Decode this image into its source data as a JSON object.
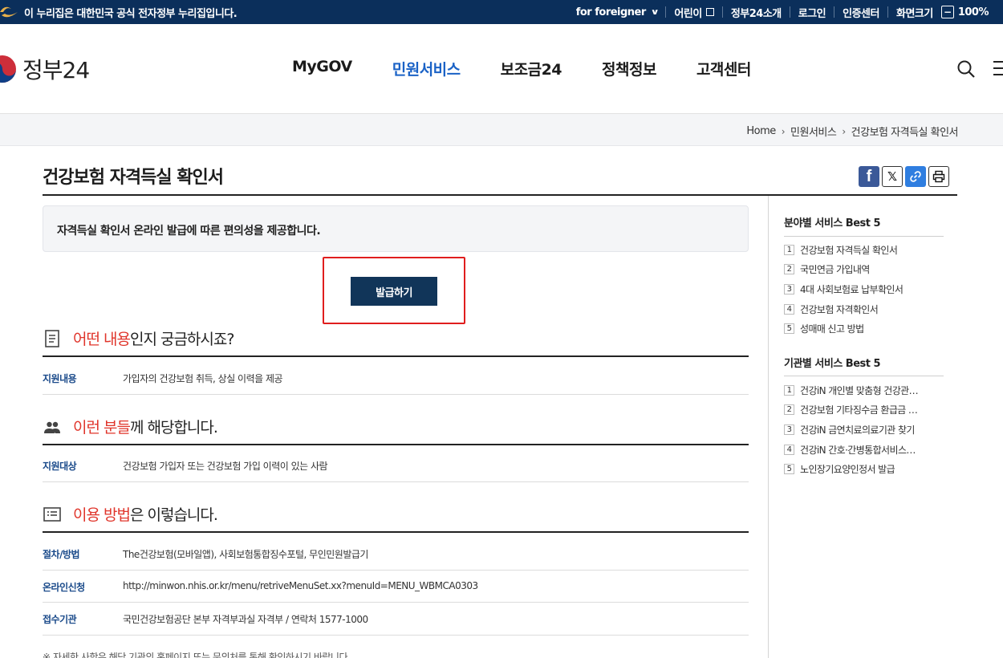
{
  "gov_banner": {
    "notice": "이 누리집은 대한민국 공식 전자정부 누리집입니다.",
    "utility_links": [
      "for foreigner",
      "어린이",
      "정부24소개",
      "로그인",
      "인증센터",
      "화면크기"
    ],
    "zoom_level": "100%"
  },
  "header": {
    "logo_text": "정부24",
    "nav": [
      "MyGOV",
      "민원서비스",
      "보조금24",
      "정책정보",
      "고객센터"
    ],
    "active_nav": "민원서비스"
  },
  "breadcrumb": [
    "Home",
    "민원서비스",
    "건강보험 자격득실 확인서"
  ],
  "page": {
    "title": "건강보험 자격득실 확인서",
    "summary": "자격득실 확인서 온라인 발급에 따른 편의성을 제공합니다.",
    "issue_button": "발급하기"
  },
  "sections": {
    "what": {
      "heading_red": "어떤 내용",
      "heading_rest": "인지 궁금하시죠?",
      "rows": [
        {
          "key": "지원내용",
          "value": "가입자의 건강보험 취득, 상실 이력을 제공"
        }
      ]
    },
    "who": {
      "heading_red": "이런 분들",
      "heading_rest": "께 해당합니다.",
      "rows": [
        {
          "key": "지원대상",
          "value": "건강보험 가입자 또는 건강보험 가입 이력이 있는 사람"
        }
      ]
    },
    "how": {
      "heading_red": "이용 방법",
      "heading_rest": "은 이렇습니다.",
      "rows": [
        {
          "key": "절차/방법",
          "value": "The건강보험(모바일앱), 사회보험통합징수포털, 무인민원발급기"
        },
        {
          "key": "온라인신청",
          "value": "http://minwon.nhis.or.kr/menu/retriveMenuSet.xx?menuId=MENU_WBMCA0303"
        },
        {
          "key": "접수기관",
          "value": "국민건강보험공단 본부 자격부과실 자격부 / 연락처 1577-1000"
        }
      ]
    }
  },
  "footnote": "※ 자세한 사항은 해당 기관의 홈페이지 또는 문의처를 통해 확인하시기 바랍니다.",
  "sidebar": {
    "field_best": {
      "title": "분야별 서비스 Best 5",
      "items": [
        "건강보험 자격득실 확인서",
        "국민연금 가입내역",
        "4대 사회보험료 납부확인서",
        "건강보험 자격확인서",
        "성매매 신고 방법"
      ]
    },
    "agency_best": {
      "title": "기관별 서비스 Best 5",
      "items": [
        "건강iN 개인별 맞춤형 건강관…",
        "건강보험 기타징수금 환급금 …",
        "건강iN 금연치료의료기관 찾기",
        "건강iN 간호·간병통합서비스…",
        "노인장기요양인정서 발급"
      ]
    }
  },
  "colors": {
    "banner_bg": "#0b2f5b",
    "active_nav": "#1a62c6",
    "issue_button_bg": "#113559",
    "highlight_border": "#e01e1e",
    "heading_red": "#e0352b",
    "row_key": "#1a4a8a"
  },
  "icons": [
    "government-emblem-icon",
    "chevron-down-icon",
    "external-link-icon",
    "minus-icon",
    "search-icon",
    "hamburger-menu-icon",
    "facebook-icon",
    "x-icon",
    "link-icon",
    "print-icon",
    "document-icon",
    "people-icon",
    "list-icon"
  ]
}
